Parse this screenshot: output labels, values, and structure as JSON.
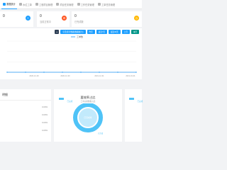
{
  "tabs": [
    {
      "label": "数据统计",
      "active": true
    },
    {
      "label": "水位工单",
      "active": false
    },
    {
      "label": "工程项目管理",
      "active": false
    },
    {
      "label": "项目任务管理",
      "active": false
    },
    {
      "label": "工作任务管理",
      "active": false
    },
    {
      "label": "工单任务管理",
      "active": false
    }
  ],
  "cards": [
    {
      "value": "0",
      "label": "",
      "badge_color": "#1e9fff",
      "badge_icon": "list-icon"
    },
    {
      "value": "0",
      "label": "当前正常中",
      "badge_color": "#ff5722",
      "badge_icon": "gear-icon"
    },
    {
      "value": "0",
      "label": "已完成数",
      "badge_color": "#ffb800",
      "badge_icon": "clock-icon"
    }
  ],
  "chart_buttons": [
    "今天(累计数据(数据统计))",
    "昨天",
    "最近7天",
    "最近30天",
    "上月",
    "本月"
  ],
  "chart_legend": "工单数",
  "x_ticks": [
    "2020-12-29",
    "2020-12-30",
    "2021-12-31",
    "2021-01-01"
  ],
  "chart_data": {
    "type": "line",
    "series": [
      {
        "name": "工单数",
        "values": [
          0,
          0,
          0,
          0,
          0,
          0,
          0,
          0
        ]
      }
    ],
    "x": [
      "2020-12-29",
      "",
      "2020-12-30",
      "",
      "2021-12-31",
      "",
      "2021-01-01",
      ""
    ],
    "xlabel": "",
    "ylabel": "",
    "grid": true,
    "legend": "top-center"
  },
  "left_panel": {
    "title": "明细",
    "values": [
      "0.00%",
      "0.00%",
      "0.00%",
      "0.00%"
    ]
  },
  "center_panel": {
    "legend": "已完成",
    "title": "要效率占比",
    "subtitle": "工单完成数据占比",
    "donut_label": "已完成率",
    "bottom_legend": "已完成"
  },
  "right_panel": {
    "legend": "已完成"
  },
  "colors": {
    "accent": "#1e9fff",
    "donut": "#4fc3f7",
    "dark": "#2f4056"
  }
}
